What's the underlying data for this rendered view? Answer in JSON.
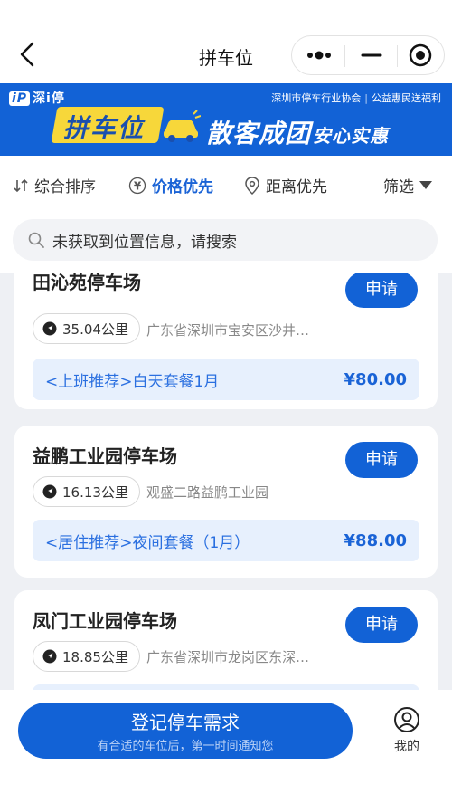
{
  "header": {
    "title": "拼车位"
  },
  "banner": {
    "brand": "深i停",
    "brand_prefix": "iP",
    "association": "深圳市停车行业协会",
    "tagline": "公益惠民送福利",
    "title_badge": "拼车位",
    "slogan_main": "散客成团",
    "slogan_sub": "安心实惠"
  },
  "sort": {
    "items": [
      {
        "label": "综合排序",
        "icon": "sort-icon"
      },
      {
        "label": "价格优先",
        "icon": "yen-icon"
      },
      {
        "label": "距离优先",
        "icon": "location-pin-icon"
      }
    ],
    "filter_label": "筛选"
  },
  "search": {
    "placeholder": "未获取到位置信息，请搜索"
  },
  "lots": [
    {
      "name": "田沁苑停车场",
      "distance": "35.04公里",
      "address": "广东省深圳市宝安区沙井…",
      "package": "<上班推荐>白天套餐1月",
      "price": "¥80.00",
      "apply_label": "申请"
    },
    {
      "name": "益鹏工业园停车场",
      "distance": "16.13公里",
      "address": "观盛二路益鹏工业园",
      "package": "<居住推荐>夜间套餐（1月）",
      "price": "¥88.00",
      "apply_label": "申请"
    },
    {
      "name": "凤门工业园停车场",
      "distance": "18.85公里",
      "address": "广东省深圳市龙岗区东深…",
      "package": "",
      "price": "",
      "apply_label": "申请"
    }
  ],
  "bottom": {
    "register_label": "登记停车需求",
    "register_sub": "有合适的车位后，第一时间通知您",
    "mine_label": "我的"
  },
  "colors": {
    "primary": "#1262d6",
    "accent": "#f7d73a",
    "package_bg": "#e7f0fd"
  }
}
